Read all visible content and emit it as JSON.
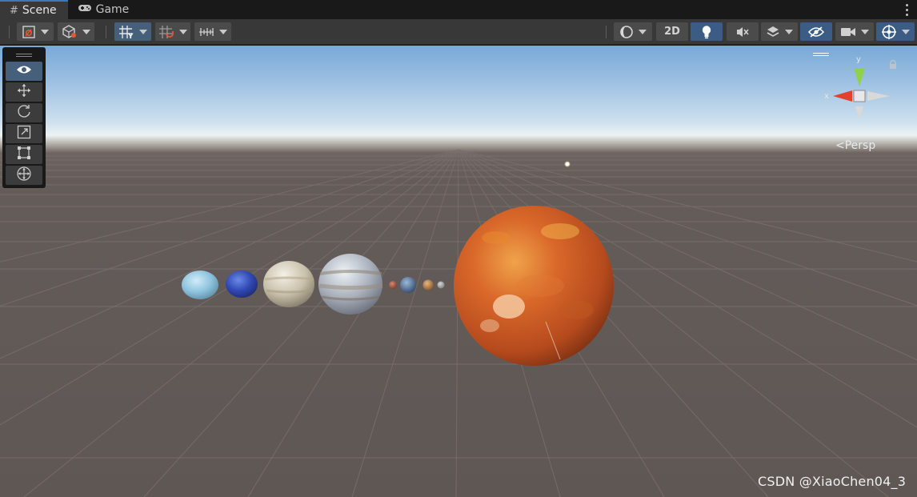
{
  "tabs": [
    {
      "label": "Scene",
      "icon": "hash-icon",
      "active": true
    },
    {
      "label": "Game",
      "icon": "gamepad-icon",
      "active": false
    }
  ],
  "toolbar": {
    "toggle_2d_label": "2D"
  },
  "gizmo": {
    "y_label": "y",
    "x_label": "x",
    "projection_label": "Persp",
    "colors": {
      "y": "#8fd14a",
      "x": "#e2412f",
      "neutral": "#d9d9d9"
    }
  },
  "tools": [
    "view-tool",
    "move-tool",
    "rotate-tool",
    "scale-tool",
    "rect-tool",
    "transform-tool"
  ],
  "watermark": "CSDN @XiaoChen04_3",
  "colors": {
    "accent": "#46607c",
    "panel_bg": "#383838",
    "sun": "#d9682a"
  }
}
